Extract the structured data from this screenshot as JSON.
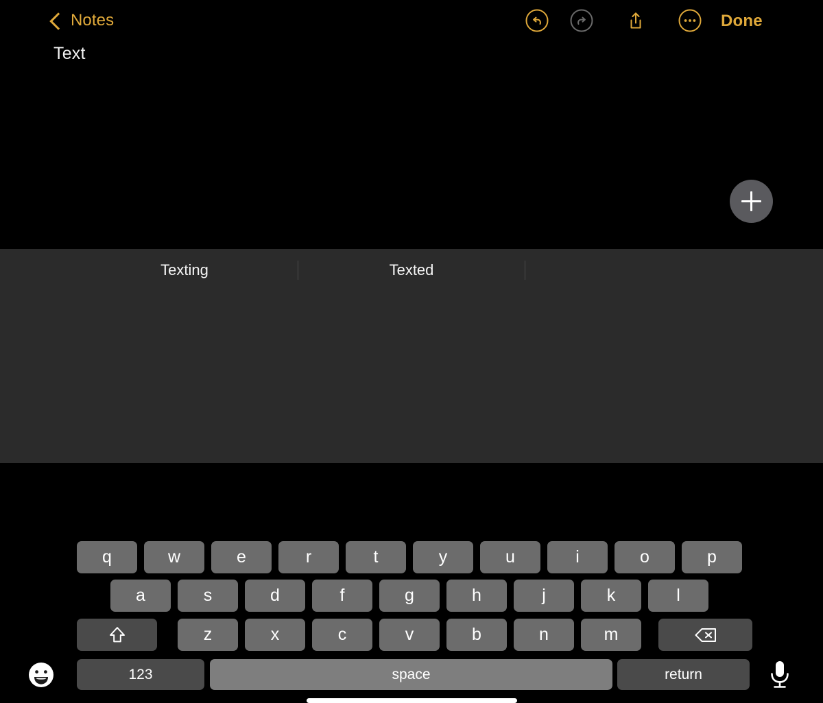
{
  "app": {
    "name": "Notes",
    "theme": "dark",
    "accent_color": "#E0A93A",
    "keyboard_bg": "#2B2B2B",
    "note_bg": "#000000"
  },
  "navbar": {
    "back_label": "Notes",
    "back_icon": "chevron-left-icon",
    "undo_icon": "undo-circle-icon",
    "undo_state": "enabled",
    "undo_color": "#E0A93A",
    "redo_icon": "redo-circle-icon",
    "redo_state": "disabled",
    "redo_color": "#6B6B6B",
    "share_icon": "share-icon",
    "more_icon": "ellipsis-circle-icon",
    "done_label": "Done"
  },
  "note": {
    "title": "Text",
    "body": "",
    "add_button_icon": "plus-icon",
    "add_button_color": "#5A5A5E"
  },
  "keyboard": {
    "predictions": [
      "Texting",
      "Texted",
      ""
    ],
    "rows": [
      {
        "id": "row1",
        "keys": [
          {
            "label": "q",
            "type": "letter"
          },
          {
            "label": "w",
            "type": "letter"
          },
          {
            "label": "e",
            "type": "letter"
          },
          {
            "label": "r",
            "type": "letter"
          },
          {
            "label": "t",
            "type": "letter"
          },
          {
            "label": "y",
            "type": "letter"
          },
          {
            "label": "u",
            "type": "letter"
          },
          {
            "label": "i",
            "type": "letter"
          },
          {
            "label": "o",
            "type": "letter"
          },
          {
            "label": "p",
            "type": "letter"
          }
        ]
      },
      {
        "id": "row2",
        "keys": [
          {
            "label": "a",
            "type": "letter"
          },
          {
            "label": "s",
            "type": "letter"
          },
          {
            "label": "d",
            "type": "letter"
          },
          {
            "label": "f",
            "type": "letter"
          },
          {
            "label": "g",
            "type": "letter"
          },
          {
            "label": "h",
            "type": "letter"
          },
          {
            "label": "j",
            "type": "letter"
          },
          {
            "label": "k",
            "type": "letter"
          },
          {
            "label": "l",
            "type": "letter"
          }
        ]
      },
      {
        "id": "row3",
        "keys": [
          {
            "label": "",
            "type": "shift",
            "icon": "shift-arrow-icon"
          },
          {
            "label": "z",
            "type": "letter"
          },
          {
            "label": "x",
            "type": "letter"
          },
          {
            "label": "c",
            "type": "letter"
          },
          {
            "label": "v",
            "type": "letter"
          },
          {
            "label": "b",
            "type": "letter"
          },
          {
            "label": "n",
            "type": "letter"
          },
          {
            "label": "m",
            "type": "letter"
          },
          {
            "label": "",
            "type": "delete",
            "icon": "backspace-icon"
          }
        ]
      },
      {
        "id": "row4",
        "keys": [
          {
            "label": "123",
            "type": "mode"
          },
          {
            "label": "space",
            "type": "space"
          },
          {
            "label": "return",
            "type": "return"
          }
        ]
      }
    ],
    "emoji_icon": "emoji-smiley-icon",
    "mic_icon": "microphone-icon",
    "key_color": "#6C6C6C",
    "special_key_color": "#4A4A4A",
    "space_key_color": "#7E7E7E"
  },
  "system": {
    "home_indicator": "home-indicator-bar"
  }
}
